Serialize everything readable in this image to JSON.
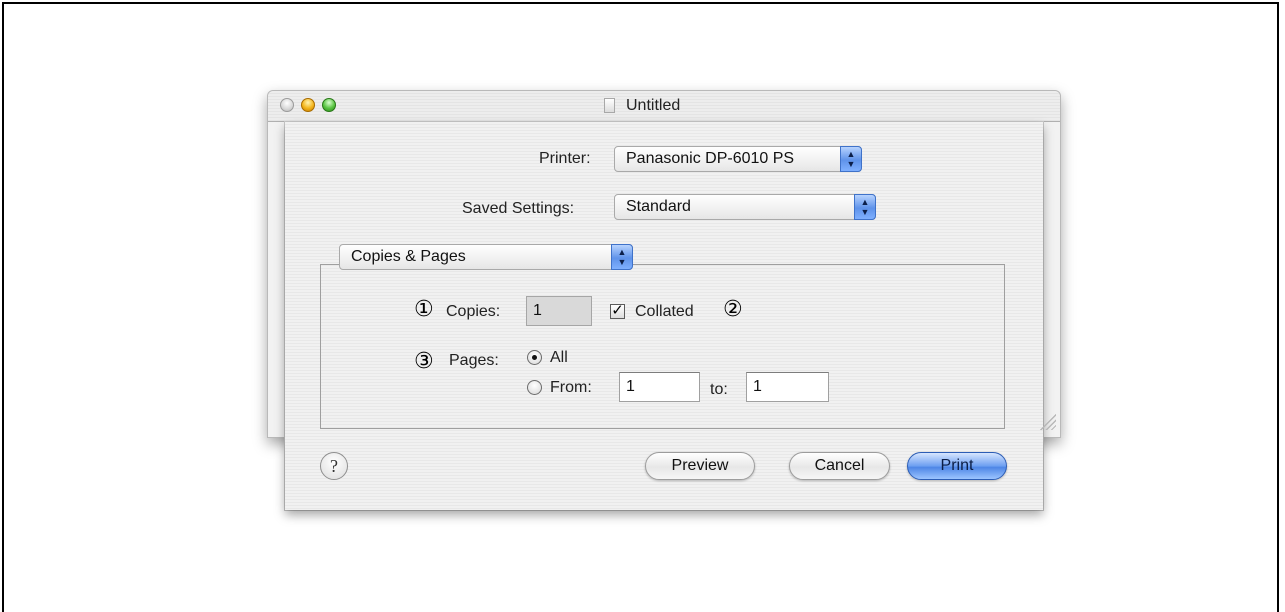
{
  "window": {
    "title": "Untitled"
  },
  "printer": {
    "label": "Printer:",
    "value": "Panasonic DP-6010 PS"
  },
  "saved_settings": {
    "label": "Saved Settings:",
    "value": "Standard"
  },
  "panel": {
    "value": "Copies & Pages"
  },
  "copies": {
    "marker": "①",
    "label": "Copies:",
    "value": "1"
  },
  "collated": {
    "label": "Collated",
    "checked": true,
    "marker": "②"
  },
  "pages": {
    "marker": "③",
    "label": "Pages:",
    "all_label": "All",
    "from_label": "From:",
    "from_value": "1",
    "to_label": "to:",
    "to_value": "1",
    "selected": "All"
  },
  "buttons": {
    "help": "?",
    "preview": "Preview",
    "cancel": "Cancel",
    "print": "Print"
  },
  "icons": {
    "check": "✓",
    "popup_arrows": "▲▼"
  }
}
